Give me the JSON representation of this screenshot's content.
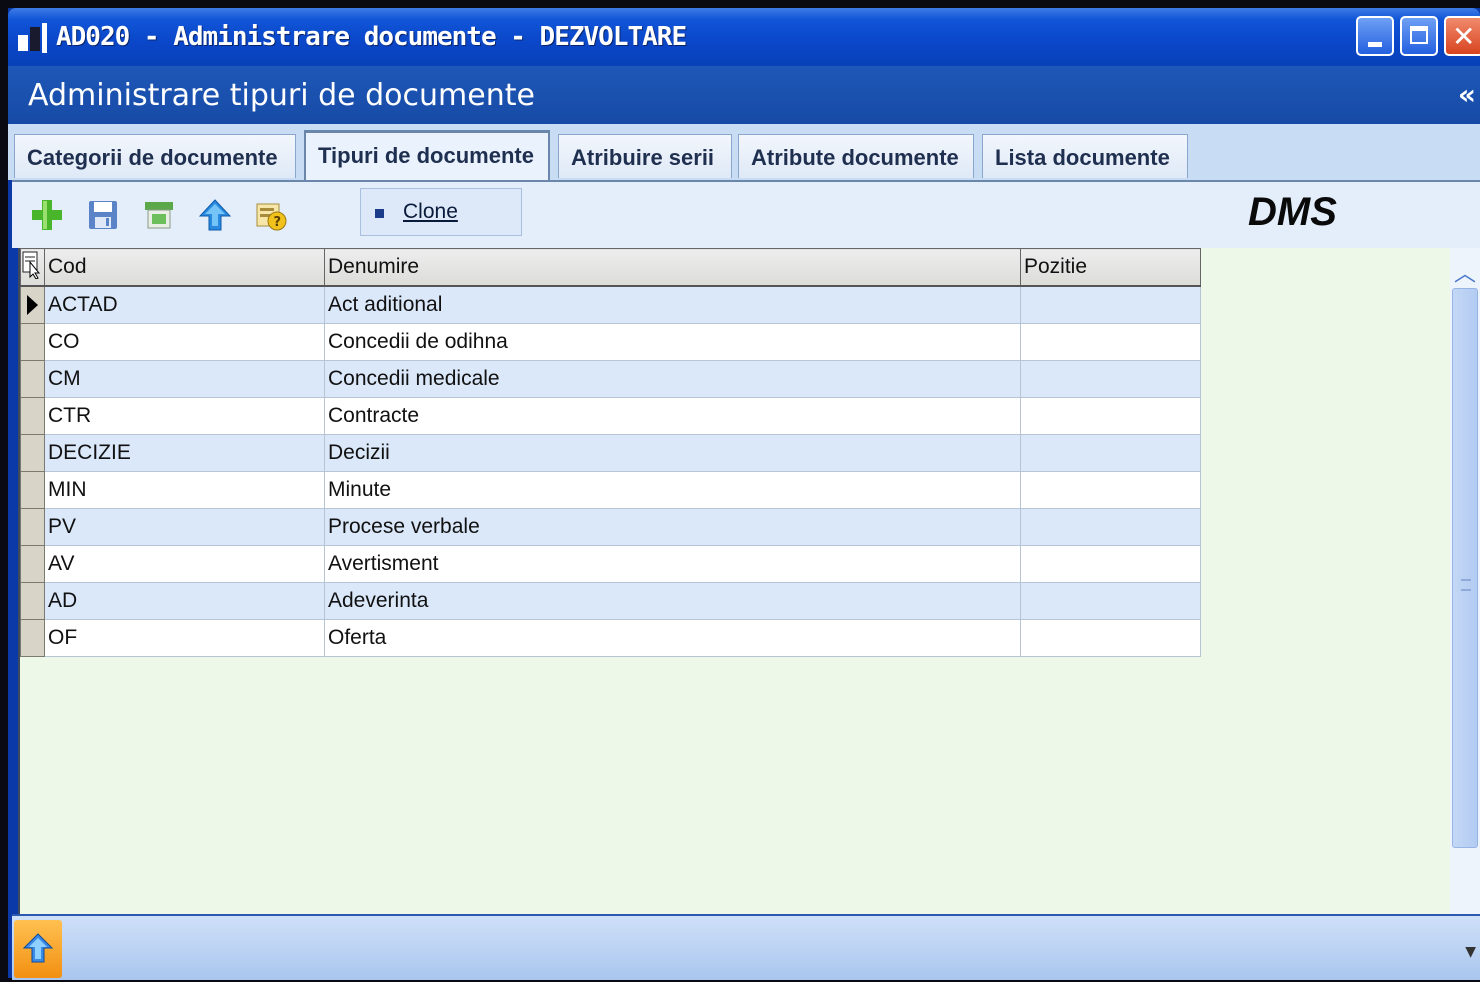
{
  "window": {
    "title": "AD020 - Administrare documente - DEZVOLTARE",
    "controls": [
      "minimize",
      "maximize",
      "close"
    ]
  },
  "header": {
    "title": "Administrare tipuri de documente",
    "collapse_glyph": "«"
  },
  "tabs": [
    {
      "label": "Categorii de documente",
      "active": false
    },
    {
      "label": "Tipuri de documente",
      "active": true
    },
    {
      "label": "Atribuire serii",
      "active": false
    },
    {
      "label": "Atribute documente",
      "active": false
    },
    {
      "label": "Lista documente",
      "active": false
    }
  ],
  "toolbar": {
    "icons": [
      "add-icon",
      "save-icon",
      "delete-icon",
      "up-arrow-icon",
      "properties-icon"
    ],
    "clone_label": "Clone",
    "brand": "DMS"
  },
  "grid": {
    "columns": [
      "Cod",
      "Denumire",
      "Pozitie"
    ],
    "rows": [
      {
        "cod": "ACTAD",
        "denumire": "Act aditional",
        "pozitie": ""
      },
      {
        "cod": "CO",
        "denumire": "Concedii de odihna",
        "pozitie": ""
      },
      {
        "cod": "CM",
        "denumire": "Concedii medicale",
        "pozitie": ""
      },
      {
        "cod": "CTR",
        "denumire": "Contracte",
        "pozitie": ""
      },
      {
        "cod": "DECIZIE",
        "denumire": "Decizii",
        "pozitie": ""
      },
      {
        "cod": "MIN",
        "denumire": "Minute",
        "pozitie": ""
      },
      {
        "cod": "PV",
        "denumire": "Procese verbale",
        "pozitie": ""
      },
      {
        "cod": "AV",
        "denumire": "Avertisment",
        "pozitie": ""
      },
      {
        "cod": "AD",
        "denumire": "Adeverinta",
        "pozitie": ""
      },
      {
        "cod": "OF",
        "denumire": "Oferta",
        "pozitie": ""
      }
    ],
    "current_row": 0
  },
  "colors": {
    "title_bar": "#0a46c8",
    "header_band": "#1e58b8",
    "row_alt": "#dbe8fa",
    "grid_bg": "#eef8e8"
  }
}
